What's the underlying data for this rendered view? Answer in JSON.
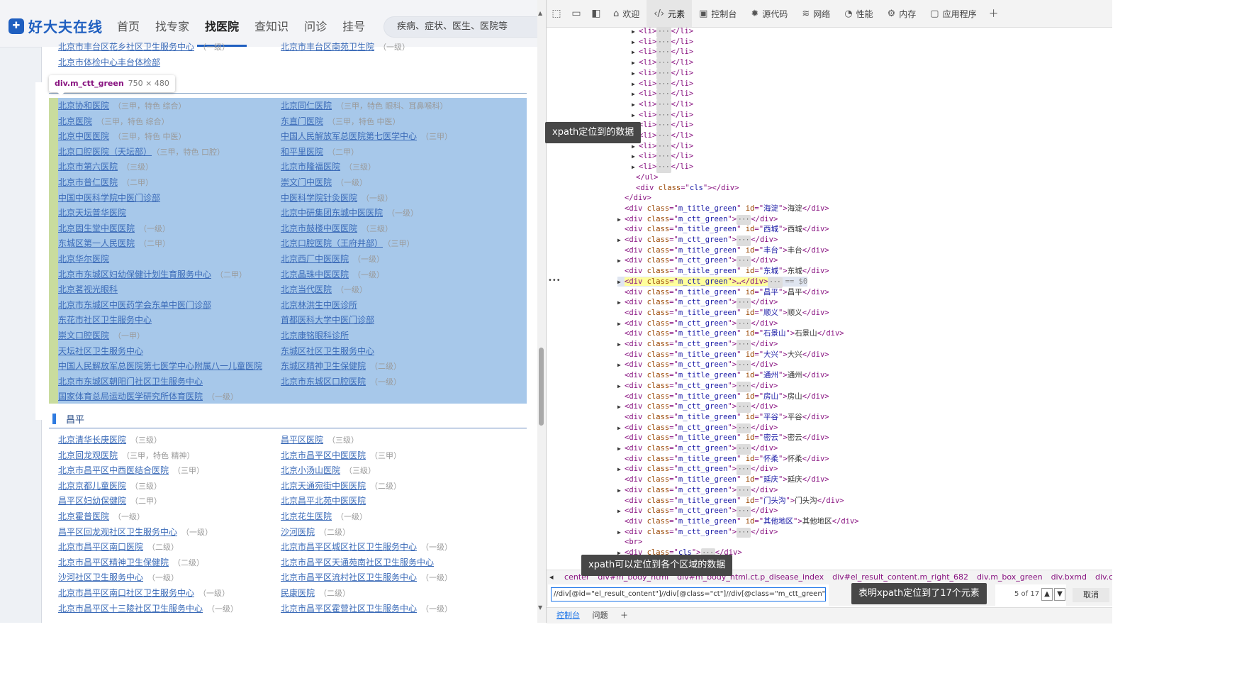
{
  "site": {
    "logo_text": "好大夫在线",
    "nav": [
      "首页",
      "找专家",
      "找医院",
      "查知识",
      "问诊",
      "挂号"
    ],
    "nav_active": "找医院",
    "search_placeholder": "疾病、症状、医生、医院等",
    "top_links": [
      {
        "name": "北京市丰台区花乡社区卫生服务中心",
        "tag": "（一级）"
      },
      {
        "name": "北京市丰台区南苑卫生院",
        "tag": "（一级）"
      },
      {
        "name": "北京市体检中心丰台体检部",
        "tag": ""
      }
    ],
    "inspector": {
      "selector": "div.m_ctt_green",
      "size": "750 × 480"
    },
    "dongcheng_left": [
      {
        "name": "北京协和医院",
        "tag": "（三甲，特色 综合）"
      },
      {
        "name": "北京医院",
        "tag": "（三甲，特色 综合）"
      },
      {
        "name": "北京中医医院",
        "tag": "（三甲，特色 中医）"
      },
      {
        "name": "北京口腔医院（天坛部）",
        "tag": "（三甲，特色 口腔）"
      },
      {
        "name": "北京市第六医院",
        "tag": "（三级）"
      },
      {
        "name": "北京市普仁医院",
        "tag": "（二甲）"
      },
      {
        "name": "中国中医科学院中医门诊部",
        "tag": ""
      },
      {
        "name": "北京天坛普华医院",
        "tag": ""
      },
      {
        "name": "北京固生堂中医医院",
        "tag": "（一级）"
      },
      {
        "name": "东城区第一人民医院",
        "tag": "（二甲）"
      },
      {
        "name": "北京华尔医院",
        "tag": ""
      },
      {
        "name": "北京市东城区妇幼保健计划生育服务中心",
        "tag": "（二甲）"
      },
      {
        "name": "北京茗视光眼科",
        "tag": ""
      },
      {
        "name": "北京市东城区中医药学会东单中医门诊部",
        "tag": ""
      },
      {
        "name": "东花市社区卫生服务中心",
        "tag": ""
      },
      {
        "name": "崇文口腔医院",
        "tag": "（一甲）"
      },
      {
        "name": "天坛社区卫生服务中心",
        "tag": ""
      },
      {
        "name": "中国人民解放军总医院第七医学中心附属八一儿童医院",
        "tag": ""
      },
      {
        "name": "北京市东城区朝阳门社区卫生服务中心",
        "tag": ""
      },
      {
        "name": "国家体育总局运动医学研究所体育医院",
        "tag": "（一级）"
      }
    ],
    "dongcheng_right": [
      {
        "name": "北京同仁医院",
        "tag": "（三甲，特色 眼科、耳鼻喉科）"
      },
      {
        "name": "东直门医院",
        "tag": "（三甲，特色 中医）"
      },
      {
        "name": "中国人民解放军总医院第七医学中心",
        "tag": "（三甲）"
      },
      {
        "name": "和平里医院",
        "tag": "（二甲）"
      },
      {
        "name": "北京市隆福医院",
        "tag": "（三级）"
      },
      {
        "name": "崇文门中医院",
        "tag": "（一级）"
      },
      {
        "name": "中医科学院针灸医院",
        "tag": "（一级）"
      },
      {
        "name": "北京中研集团东城中医医院",
        "tag": "（一级）"
      },
      {
        "name": "北京市鼓楼中医医院",
        "tag": "（三级）"
      },
      {
        "name": "北京口腔医院（王府井部）",
        "tag": "（三甲）"
      },
      {
        "name": "北京西厂中医医院",
        "tag": "（一级）"
      },
      {
        "name": "北京晶珠中医医院",
        "tag": "（一级）"
      },
      {
        "name": "北京当代医院",
        "tag": "（一级）"
      },
      {
        "name": "北京林洪生中医诊所",
        "tag": ""
      },
      {
        "name": "首都医科大学中医门诊部",
        "tag": ""
      },
      {
        "name": "北京康铭眼科诊所",
        "tag": ""
      },
      {
        "name": "东城区社区卫生服务中心",
        "tag": ""
      },
      {
        "name": "东城区精神卫生保健院",
        "tag": "（二级）"
      },
      {
        "name": "北京市东城区口腔医院",
        "tag": "（一级）"
      }
    ],
    "changping_title": "昌平",
    "changping_left": [
      {
        "name": "北京清华长庚医院",
        "tag": "（三级）"
      },
      {
        "name": "北京回龙观医院",
        "tag": "（三甲，特色 精神）"
      },
      {
        "name": "北京市昌平区中西医结合医院",
        "tag": "（三甲）"
      },
      {
        "name": "北京京都儿童医院",
        "tag": "（三级）"
      },
      {
        "name": "昌平区妇幼保健院",
        "tag": "（二甲）"
      },
      {
        "name": "北京霍普医院",
        "tag": "（一级）"
      },
      {
        "name": "昌平区回龙观社区卫生服务中心",
        "tag": "（一级）"
      },
      {
        "name": "北京市昌平区南口医院",
        "tag": "（二级）"
      },
      {
        "name": "北京市昌平区精神卫生保健院",
        "tag": "（二级）"
      },
      {
        "name": "沙河社区卫生服务中心",
        "tag": "（一级）"
      },
      {
        "name": "北京市昌平区南口社区卫生服务中心",
        "tag": "（一级）"
      },
      {
        "name": "北京市昌平区十三陵社区卫生服务中心",
        "tag": "（一级）"
      }
    ],
    "changping_right": [
      {
        "name": "昌平区医院",
        "tag": "（三级）"
      },
      {
        "name": "北京市昌平区中医医院",
        "tag": "（三甲）"
      },
      {
        "name": "北京小汤山医院",
        "tag": "（三级）"
      },
      {
        "name": "北京天通宛街中医医院",
        "tag": "（二级）"
      },
      {
        "name": "北京昌平北苑中医医院",
        "tag": ""
      },
      {
        "name": "北京花生医院",
        "tag": "（一级）"
      },
      {
        "name": "沙河医院",
        "tag": "（二级）"
      },
      {
        "name": "北京市昌平区城区社区卫生服务中心",
        "tag": "（一级）"
      },
      {
        "name": "北京市昌平区天通苑南社区卫生服务中心",
        "tag": ""
      },
      {
        "name": "北京市昌平区流村社区卫生服务中心",
        "tag": "（一级）"
      },
      {
        "name": "民康医院",
        "tag": "（二级）"
      },
      {
        "name": "北京市昌平区霍营社区卫生服务中心",
        "tag": "（一级）"
      }
    ]
  },
  "devtools": {
    "tabs": [
      "欢迎",
      "元素",
      "控制台",
      "源代码",
      "网络",
      "性能",
      "内存",
      "应用程序"
    ],
    "tab_icons": [
      "home-icon",
      "code-icon",
      "console-icon",
      "bug-icon",
      "wifi-icon",
      "performance-icon",
      "memory-icon",
      "application-icon"
    ],
    "active_tab": "元素",
    "tree_lines": [
      {
        "indent": 2,
        "caret": "▶",
        "html": "li"
      },
      {
        "indent": 2,
        "caret": "▶",
        "html": "li"
      },
      {
        "indent": 2,
        "caret": "▶",
        "html": "li"
      },
      {
        "indent": 2,
        "caret": "▶",
        "html": "li"
      },
      {
        "indent": 2,
        "caret": "▶",
        "html": "li"
      },
      {
        "indent": 2,
        "caret": "▶",
        "html": "li"
      },
      {
        "indent": 2,
        "caret": "▶",
        "html": "li"
      },
      {
        "indent": 2,
        "caret": "▶",
        "html": "li"
      },
      {
        "indent": 2,
        "caret": "▶",
        "html": "li"
      },
      {
        "indent": 2,
        "caret": "▶",
        "html": "li"
      },
      {
        "indent": 2,
        "caret": "▶",
        "html": "li"
      },
      {
        "indent": 2,
        "caret": "▶",
        "html": "li"
      },
      {
        "indent": 2,
        "caret": "▶",
        "html": "li"
      },
      {
        "indent": 2,
        "caret": "▶",
        "html": "li"
      },
      {
        "indent": 1,
        "caret": "",
        "html": "/ul"
      },
      {
        "indent": 1,
        "caret": "",
        "html": "div",
        "cls": "cls",
        "close": true
      },
      {
        "indent": 0,
        "caret": "",
        "html": "/div"
      },
      {
        "indent": 0,
        "caret": "",
        "html": "title",
        "cls": "m_title_green",
        "id": "海淀",
        "text": "海淀"
      },
      {
        "indent": 0,
        "caret": "▶",
        "html": "ctt"
      },
      {
        "indent": 0,
        "caret": "",
        "html": "title",
        "cls": "m_title_green",
        "id": "西城",
        "text": "西城"
      },
      {
        "indent": 0,
        "caret": "▶",
        "html": "ctt"
      },
      {
        "indent": 0,
        "caret": "",
        "html": "title",
        "cls": "m_title_green",
        "id": "丰台",
        "text": "丰台"
      },
      {
        "indent": 0,
        "caret": "▶",
        "html": "ctt"
      },
      {
        "indent": 0,
        "caret": "",
        "html": "title",
        "cls": "m_title_green",
        "id": "东城",
        "text": "东城"
      },
      {
        "indent": 0,
        "caret": "▶",
        "html": "sel"
      },
      {
        "indent": 0,
        "caret": "",
        "html": "title",
        "cls": "m_title_green",
        "id": "昌平",
        "text": "昌平"
      },
      {
        "indent": 0,
        "caret": "▶",
        "html": "ctt"
      },
      {
        "indent": 0,
        "caret": "",
        "html": "title",
        "cls": "m_title_green",
        "id": "顺义",
        "text": "顺义"
      },
      {
        "indent": 0,
        "caret": "▶",
        "html": "ctt"
      },
      {
        "indent": 0,
        "caret": "",
        "html": "title",
        "cls": "m_title_green",
        "id": "石景山",
        "text": "石景山"
      },
      {
        "indent": 0,
        "caret": "▶",
        "html": "ctt"
      },
      {
        "indent": 0,
        "caret": "",
        "html": "title",
        "cls": "m_title_green",
        "id": "大兴",
        "text": "大兴"
      },
      {
        "indent": 0,
        "caret": "▶",
        "html": "ctt"
      },
      {
        "indent": 0,
        "caret": "",
        "html": "title",
        "cls": "m_title_green",
        "id": "通州",
        "text": "通州"
      },
      {
        "indent": 0,
        "caret": "▶",
        "html": "ctt"
      },
      {
        "indent": 0,
        "caret": "",
        "html": "title",
        "cls": "m_title_green",
        "id": "房山",
        "text": "房山"
      },
      {
        "indent": 0,
        "caret": "▶",
        "html": "ctt"
      },
      {
        "indent": 0,
        "caret": "",
        "html": "title",
        "cls": "m_title_green",
        "id": "平谷",
        "text": "平谷"
      },
      {
        "indent": 0,
        "caret": "▶",
        "html": "ctt"
      },
      {
        "indent": 0,
        "caret": "",
        "html": "title",
        "cls": "m_title_green",
        "id": "密云",
        "text": "密云"
      },
      {
        "indent": 0,
        "caret": "▶",
        "html": "ctt"
      },
      {
        "indent": 0,
        "caret": "",
        "html": "title",
        "cls": "m_title_green",
        "id": "怀柔",
        "text": "怀柔"
      },
      {
        "indent": 0,
        "caret": "▶",
        "html": "ctt"
      },
      {
        "indent": 0,
        "caret": "",
        "html": "title",
        "cls": "m_title_green",
        "id": "延庆",
        "text": "延庆"
      },
      {
        "indent": 0,
        "caret": "▶",
        "html": "ctt"
      },
      {
        "indent": 0,
        "caret": "",
        "html": "title",
        "cls": "m_title_green",
        "id": "门头沟",
        "text": "门头沟"
      },
      {
        "indent": 0,
        "caret": "▶",
        "html": "ctt"
      },
      {
        "indent": 0,
        "caret": "",
        "html": "title",
        "cls": "m_title_green",
        "id": "其他地区",
        "text": "其他地区"
      },
      {
        "indent": 0,
        "caret": "▶",
        "html": "ctt"
      },
      {
        "indent": 0,
        "caret": "",
        "html": "br"
      },
      {
        "indent": 0,
        "caret": "▶",
        "html": "div",
        "cls": "cls",
        "close": true,
        "dots": true
      }
    ],
    "selected_suffix": "== $0",
    "breadcrumb": [
      "center",
      "div#m_body_html",
      "div#m_body_html.ct.p_disease_index",
      "div#el_result_content.m_right_682",
      "div.m_box_green",
      "div.bxmd",
      "div.ct",
      "div.m_ctt_green"
    ],
    "xpath_value": "//div[@id=\"el_result_content\"]//div[@class=\"ct\"]//div[@class=\"m_ctt_green\"]",
    "match_count": "5 of 17",
    "cancel_label": "取消",
    "drawer_tabs": [
      "控制台",
      "问题"
    ]
  },
  "annotations": {
    "note1": "xpath定位到的数据",
    "note2": "xpath可以定位到各个区域的数据",
    "note3": "表明xpath定位到了17个元素"
  }
}
